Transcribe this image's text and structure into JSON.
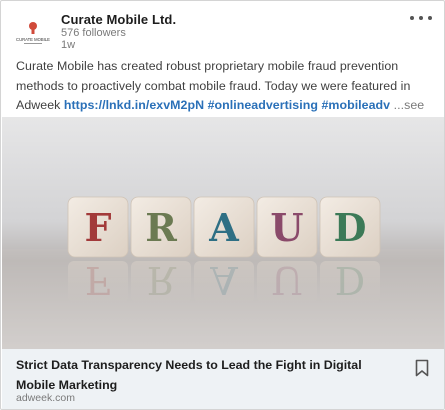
{
  "post": {
    "company_name": "Curate Mobile Ltd.",
    "followers": "576 followers",
    "time_ago": "1w",
    "logo_text": "CURATE MOBILE",
    "text_plain": "Curate Mobile has created robust proprietary mobile fraud prevention methods to proactively combat mobile fraud. Today we were featured in Adweek ",
    "link_text": "https://lnkd.in/exvM2pN #onlineadvertising #mobileadv",
    "see_more": "...see more",
    "more_icon": "more-horizontal-icon"
  },
  "image": {
    "letters": [
      "F",
      "R",
      "A",
      "U",
      "D"
    ],
    "letter_colors": [
      "#a23a3a",
      "#6b7a52",
      "#2e6f84",
      "#8a4a6a",
      "#3c7a57"
    ],
    "background": "#d9d9da"
  },
  "article": {
    "title": "Strict Data Transparency Needs to Lead the Fight in Digital Mobile Marketing",
    "source": "adweek.com",
    "bookmark_icon": "bookmark-icon"
  }
}
